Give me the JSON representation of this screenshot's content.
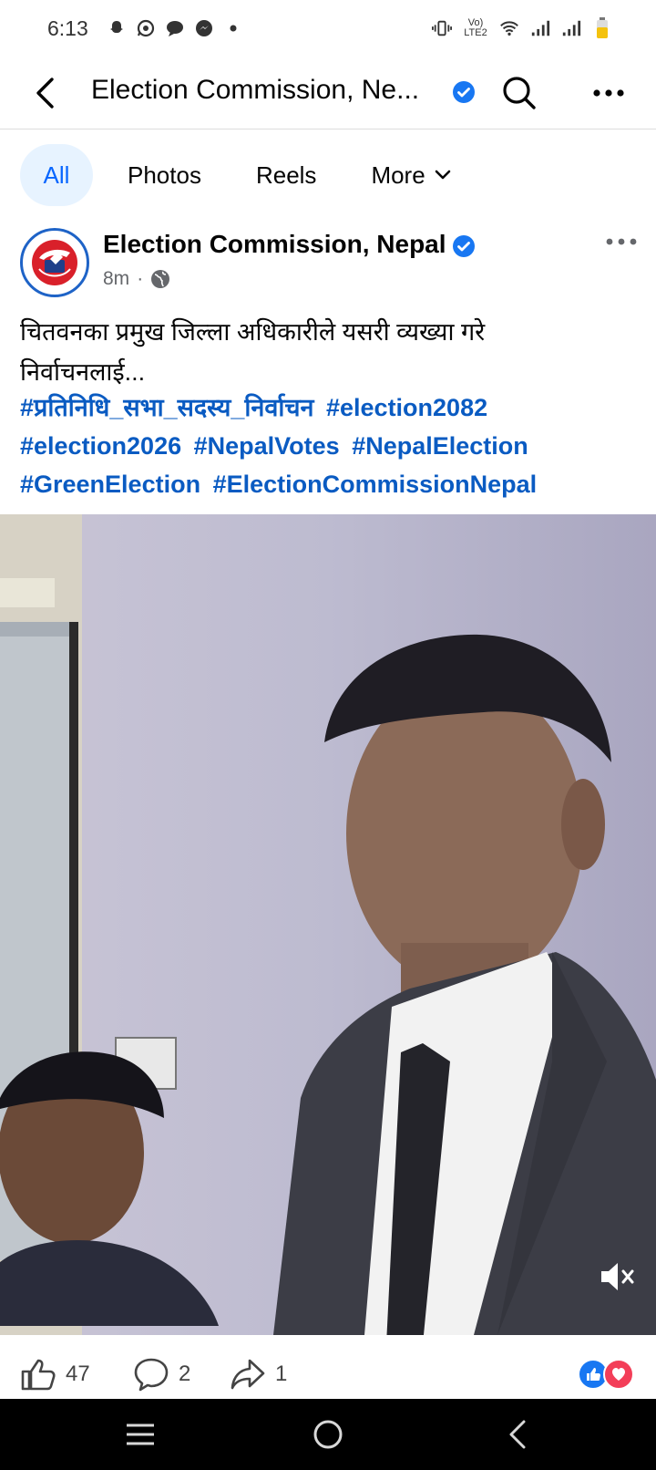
{
  "status_bar": {
    "time": "6:13",
    "network_label": "Vo) LTE2",
    "icons": [
      "snapchat-icon",
      "whatsapp-icon",
      "chat-icon",
      "messenger-icon",
      "dot-icon",
      "vibrate-icon",
      "wifi-icon",
      "signal-icon",
      "signal-icon",
      "battery-icon"
    ]
  },
  "header": {
    "title": "Election Commission, Ne...",
    "verified": true
  },
  "tabs": [
    {
      "label": "All",
      "active": true
    },
    {
      "label": "Photos",
      "active": false
    },
    {
      "label": "Reels",
      "active": false
    },
    {
      "label": "More",
      "active": false
    }
  ],
  "post": {
    "author": "Election Commission, Nepal",
    "time": "8m",
    "separator": "·",
    "audience": "public",
    "text_line1": "चितवनका प्रमुख जिल्ला अधिकारीले यसरी व्यख्या गरे",
    "text_line2": "निर्वाचनलाई...",
    "hashtags": [
      "#प्रतिनिधि_सभा_सदस्य_निर्वाचन",
      "#election2082",
      "#election2026",
      "#NepalVotes",
      "#NepalElection",
      "#GreenElection",
      "#ElectionCommissionNepal"
    ]
  },
  "actions": {
    "likes": "47",
    "comments": "2",
    "shares": "1"
  },
  "colors": {
    "accent": "#0866ff",
    "hashtag": "#0a5bc2",
    "verified": "#1877f2",
    "like": "#1877f2",
    "love": "#f33e58"
  }
}
